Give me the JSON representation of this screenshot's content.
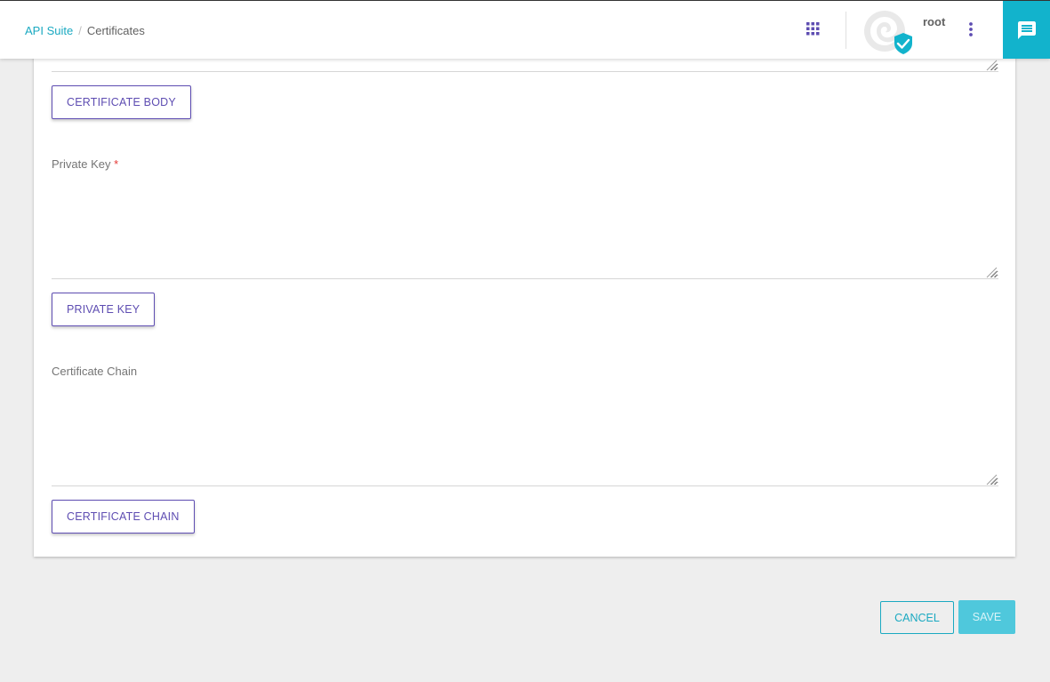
{
  "header": {
    "breadcrumb": {
      "parent": "API Suite",
      "separator": "/",
      "current": "Certificates"
    },
    "apps_icon": "apps-grid-icon",
    "user": {
      "name": "root",
      "avatar_icon": "avatar-logo-icon",
      "verified_icon": "verified-check-icon"
    },
    "more_icon": "more-vert-icon",
    "chat_icon": "chat-message-icon"
  },
  "form": {
    "certificate_body": {
      "button_label": "CERTIFICATE BODY"
    },
    "private_key": {
      "label": "Private Key",
      "required_marker": "*",
      "value": "",
      "button_label": "PRIVATE KEY"
    },
    "certificate_chain": {
      "label": "Certificate Chain",
      "value": "",
      "button_label": "CERTIFICATE CHAIN"
    }
  },
  "footer": {
    "cancel_label": "CANCEL",
    "save_label": "SAVE"
  },
  "colors": {
    "accent_teal": "#1aa9c1",
    "accent_purple": "#5e4db2",
    "required_red": "#e53935",
    "save_disabled": "#4fc8dc",
    "chat_button": "#12b3cc"
  }
}
